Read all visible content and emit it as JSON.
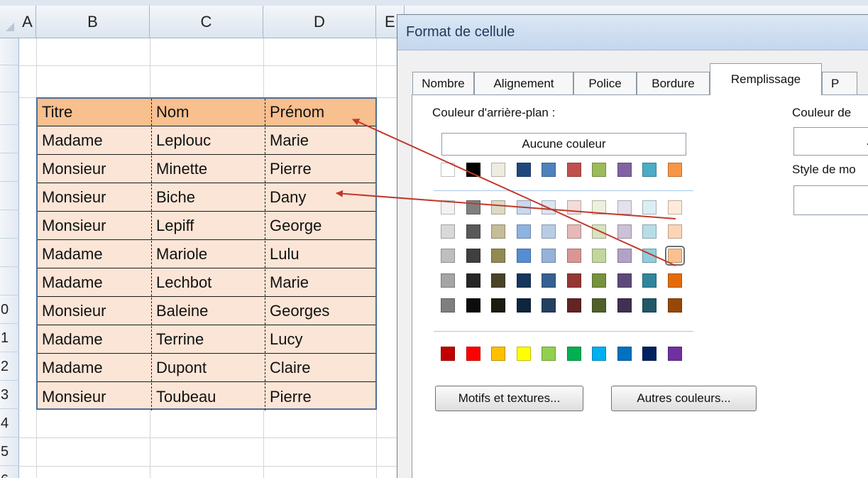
{
  "columns": [
    "A",
    "B",
    "C",
    "D",
    "E"
  ],
  "row_numbers": [
    "",
    "",
    "",
    "",
    "",
    "",
    "",
    "",
    "",
    "0",
    "1",
    "2",
    "3",
    "4",
    "5",
    "6"
  ],
  "table": {
    "headers": [
      "Titre",
      "Nom",
      "Prénom"
    ],
    "rows": [
      [
        "Madame",
        "Leplouc",
        "Marie"
      ],
      [
        "Monsieur",
        "Minette",
        "Pierre"
      ],
      [
        "Monsieur",
        "Biche",
        "Dany"
      ],
      [
        "Monsieur",
        "Lepiff",
        "George"
      ],
      [
        "Madame",
        "Mariole",
        "Lulu"
      ],
      [
        "Madame",
        "Lechbot",
        "Marie"
      ],
      [
        "Monsieur",
        "Baleine",
        "Georges"
      ],
      [
        "Madame",
        "Terrine",
        "Lucy"
      ],
      [
        "Madame",
        "Dupont",
        "Claire"
      ],
      [
        "Monsieur",
        "Toubeau",
        "Pierre"
      ]
    ],
    "header_color": "#f8bf8f",
    "body_color": "#fbe5d6"
  },
  "dialog": {
    "title": "Format de cellule",
    "tabs": [
      "Nombre",
      "Alignement",
      "Police",
      "Bordure",
      "Remplissage",
      "P"
    ],
    "active_tab": "Remplissage",
    "background_color_label": "Couleur d'arrière-plan :",
    "no_color_button": "Aucune couleur",
    "pattern_color_label": "Couleur de",
    "pattern_color_value": "A",
    "pattern_style_label": "Style de mo",
    "patterns_button": "Motifs et textures...",
    "more_colors_button": "Autres couleurs...",
    "theme_colors": [
      [
        "#ffffff",
        "#000000",
        "#eeece1",
        "#1f497d",
        "#4f81bd",
        "#c0504d",
        "#9bbb59",
        "#8064a2",
        "#4bacc6",
        "#f79646"
      ],
      [
        "#f2f2f2",
        "#7f7f7f",
        "#ddd9c4",
        "#c6d9f0",
        "#dbe5f1",
        "#f2dcdb",
        "#ebf1dd",
        "#e5e0ec",
        "#dbeef3",
        "#fdeada"
      ],
      [
        "#d8d8d8",
        "#595959",
        "#c4bd97",
        "#8db3e2",
        "#b8cce4",
        "#e5b9b7",
        "#d7e3bc",
        "#ccc1d9",
        "#b7dde8",
        "#fbd5b5"
      ],
      [
        "#bfbfbf",
        "#3f3f3f",
        "#938953",
        "#548dd4",
        "#95b3d7",
        "#d99694",
        "#c3d69b",
        "#b2a2c7",
        "#92cddc",
        "#fac08f"
      ],
      [
        "#a5a5a5",
        "#262626",
        "#494429",
        "#17365d",
        "#366092",
        "#953734",
        "#76923c",
        "#5f497a",
        "#31859b",
        "#e36c09"
      ],
      [
        "#7f7f7f",
        "#0c0c0c",
        "#1d1b10",
        "#0f243e",
        "#244061",
        "#632423",
        "#4f6128",
        "#3f3151",
        "#205867",
        "#974806"
      ]
    ],
    "standard_colors": [
      "#c00000",
      "#ff0000",
      "#ffc000",
      "#ffff00",
      "#92d050",
      "#00b050",
      "#00b0f0",
      "#0070c0",
      "#002060",
      "#7030a0"
    ],
    "selected_color": "#fac08f"
  },
  "annotation": {
    "arrow_color": "#c0392b"
  }
}
